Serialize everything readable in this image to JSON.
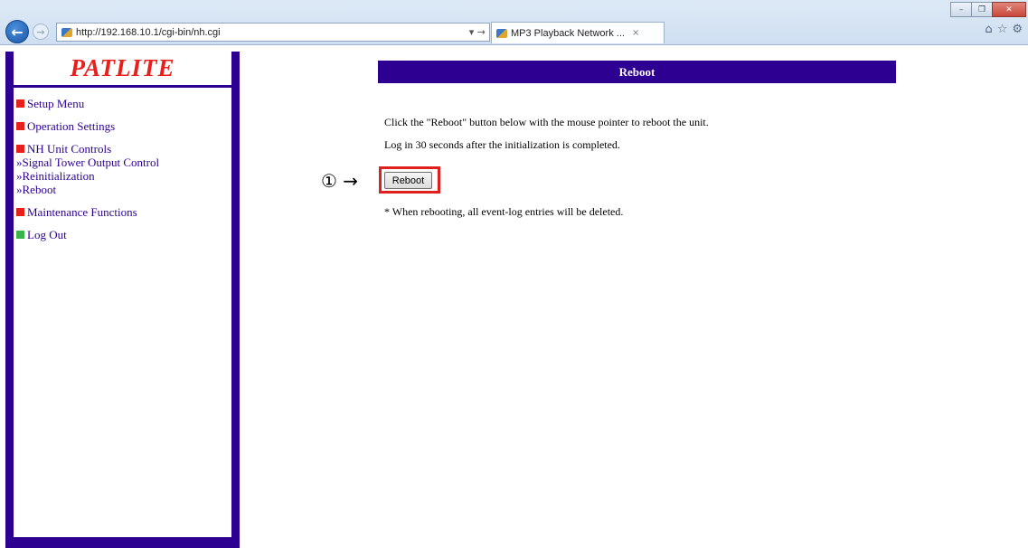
{
  "browser": {
    "address": "http://192.168.10.1/cgi-bin/nh.cgi",
    "address_controls": "▾ →",
    "tab_title": "MP3 Playback Network ...",
    "tab_close": "×",
    "window_buttons": [
      "–",
      "❐",
      "✕"
    ]
  },
  "sidebar": {
    "logo": "PATLITE",
    "menu": [
      {
        "label": "Setup Menu",
        "color": "#e8201c"
      },
      {
        "label": "Operation Settings",
        "color": "#e8201c"
      },
      {
        "label": "NH Unit Controls",
        "color": "#e8201c",
        "links": [
          "»Signal Tower Output Control",
          "»Reinitialization",
          "»Reboot"
        ]
      },
      {
        "label": "Maintenance Functions",
        "color": "#e8201c"
      },
      {
        "label": "Log Out",
        "color": "#3bb34a"
      }
    ]
  },
  "main": {
    "header": "Reboot",
    "line1": "Click the \"Reboot\" button below with the mouse pointer to reboot the unit.",
    "line2": "Log in 30 seconds after the initialization is completed.",
    "annotation": "① →",
    "reboot_button": "Reboot",
    "note": "* When rebooting, all event-log entries will be deleted."
  },
  "colors": {
    "frame_purple": "#2d0092",
    "logo_red": "#e8201c",
    "highlight_red": "#e0201c",
    "logout_green": "#3bb34a"
  }
}
